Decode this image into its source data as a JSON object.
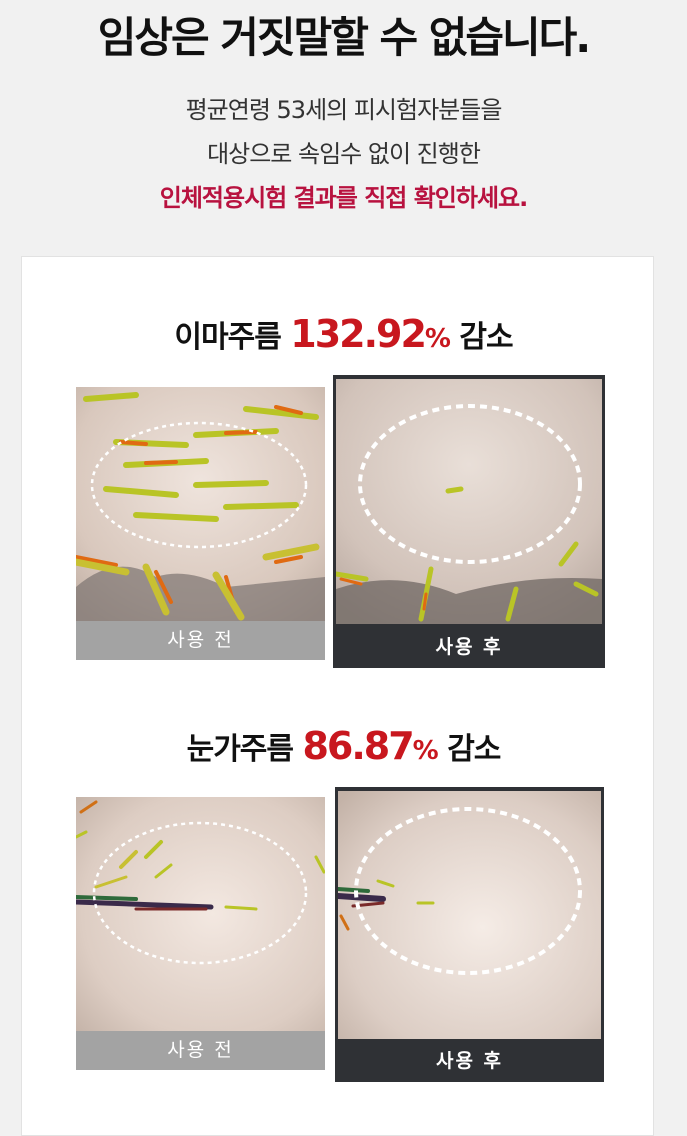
{
  "header": {
    "headline": "임상은 거짓말할 수 없습니다.",
    "line1": "평균연령 53세의 피시험자분들을",
    "line2": "대상으로 속임수 없이 진행한",
    "line3": "인체적용시험 결과를 직접 확인하세요."
  },
  "results": [
    {
      "prefix": "이마주름",
      "value": "132.92",
      "unit": "%",
      "suffix": "감소",
      "before_label": "사용 전",
      "after_label": "사용 후"
    },
    {
      "prefix": "눈가주름",
      "value": "86.87",
      "unit": "%",
      "suffix": "감소",
      "before_label": "사용 전",
      "after_label": "사용 후"
    }
  ],
  "colors": {
    "accent_red": "#c8171e",
    "accent_magenta": "#b8123f",
    "after_label_bg": "#2f3135",
    "before_label_bg": "#a3a3a3"
  }
}
